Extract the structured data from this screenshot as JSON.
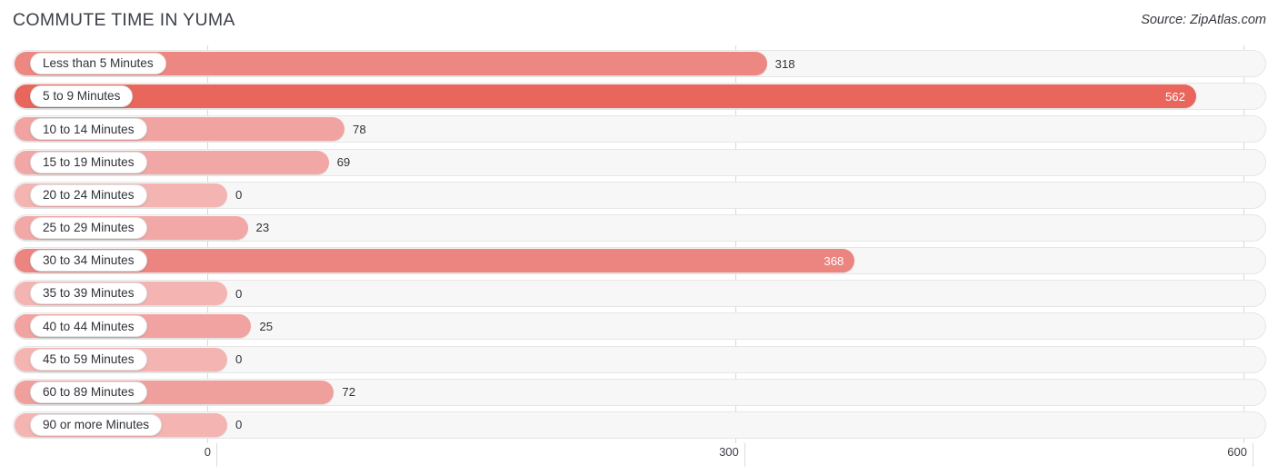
{
  "header": {
    "title": "COMMUTE TIME IN YUMA",
    "source": "Source: ZipAtlas.com"
  },
  "chart_data": {
    "type": "bar",
    "orientation": "horizontal",
    "title": "COMMUTE TIME IN YUMA",
    "xlabel": "",
    "ylabel": "",
    "xlim": [
      0,
      600
    ],
    "ticks": [
      "0",
      "300",
      "600"
    ],
    "tick_values": [
      0,
      300,
      600
    ],
    "grid": true,
    "legend": false,
    "categories": [
      "Less than 5 Minutes",
      "5 to 9 Minutes",
      "10 to 14 Minutes",
      "15 to 19 Minutes",
      "20 to 24 Minutes",
      "25 to 29 Minutes",
      "30 to 34 Minutes",
      "35 to 39 Minutes",
      "40 to 44 Minutes",
      "45 to 59 Minutes",
      "60 to 89 Minutes",
      "90 or more Minutes"
    ],
    "values": [
      318,
      562,
      78,
      69,
      0,
      23,
      368,
      0,
      25,
      0,
      72,
      0
    ],
    "value_labels": [
      "318",
      "562",
      "78",
      "69",
      "0",
      "23",
      "368",
      "0",
      "25",
      "0",
      "72",
      "0"
    ],
    "bar_colors": [
      "#ed8781",
      "#e8665c",
      "#f0a3a1",
      "#f1a7a5",
      "#f3b4b2",
      "#f1a8a6",
      "#ec8480",
      "#f3b4b2",
      "#f0a3a1",
      "#f3b4b2",
      "#efa09d",
      "#f3b4b2"
    ],
    "label_inside": [
      false,
      true,
      false,
      false,
      false,
      false,
      true,
      false,
      false,
      false,
      false,
      false
    ]
  },
  "style": {
    "track_fill": "#f7f7f7",
    "track_border": "#e6e6e6",
    "gridline_color": "#d8d8d8",
    "pill_fill": "#ffffff",
    "text_color": "#2f3238"
  }
}
